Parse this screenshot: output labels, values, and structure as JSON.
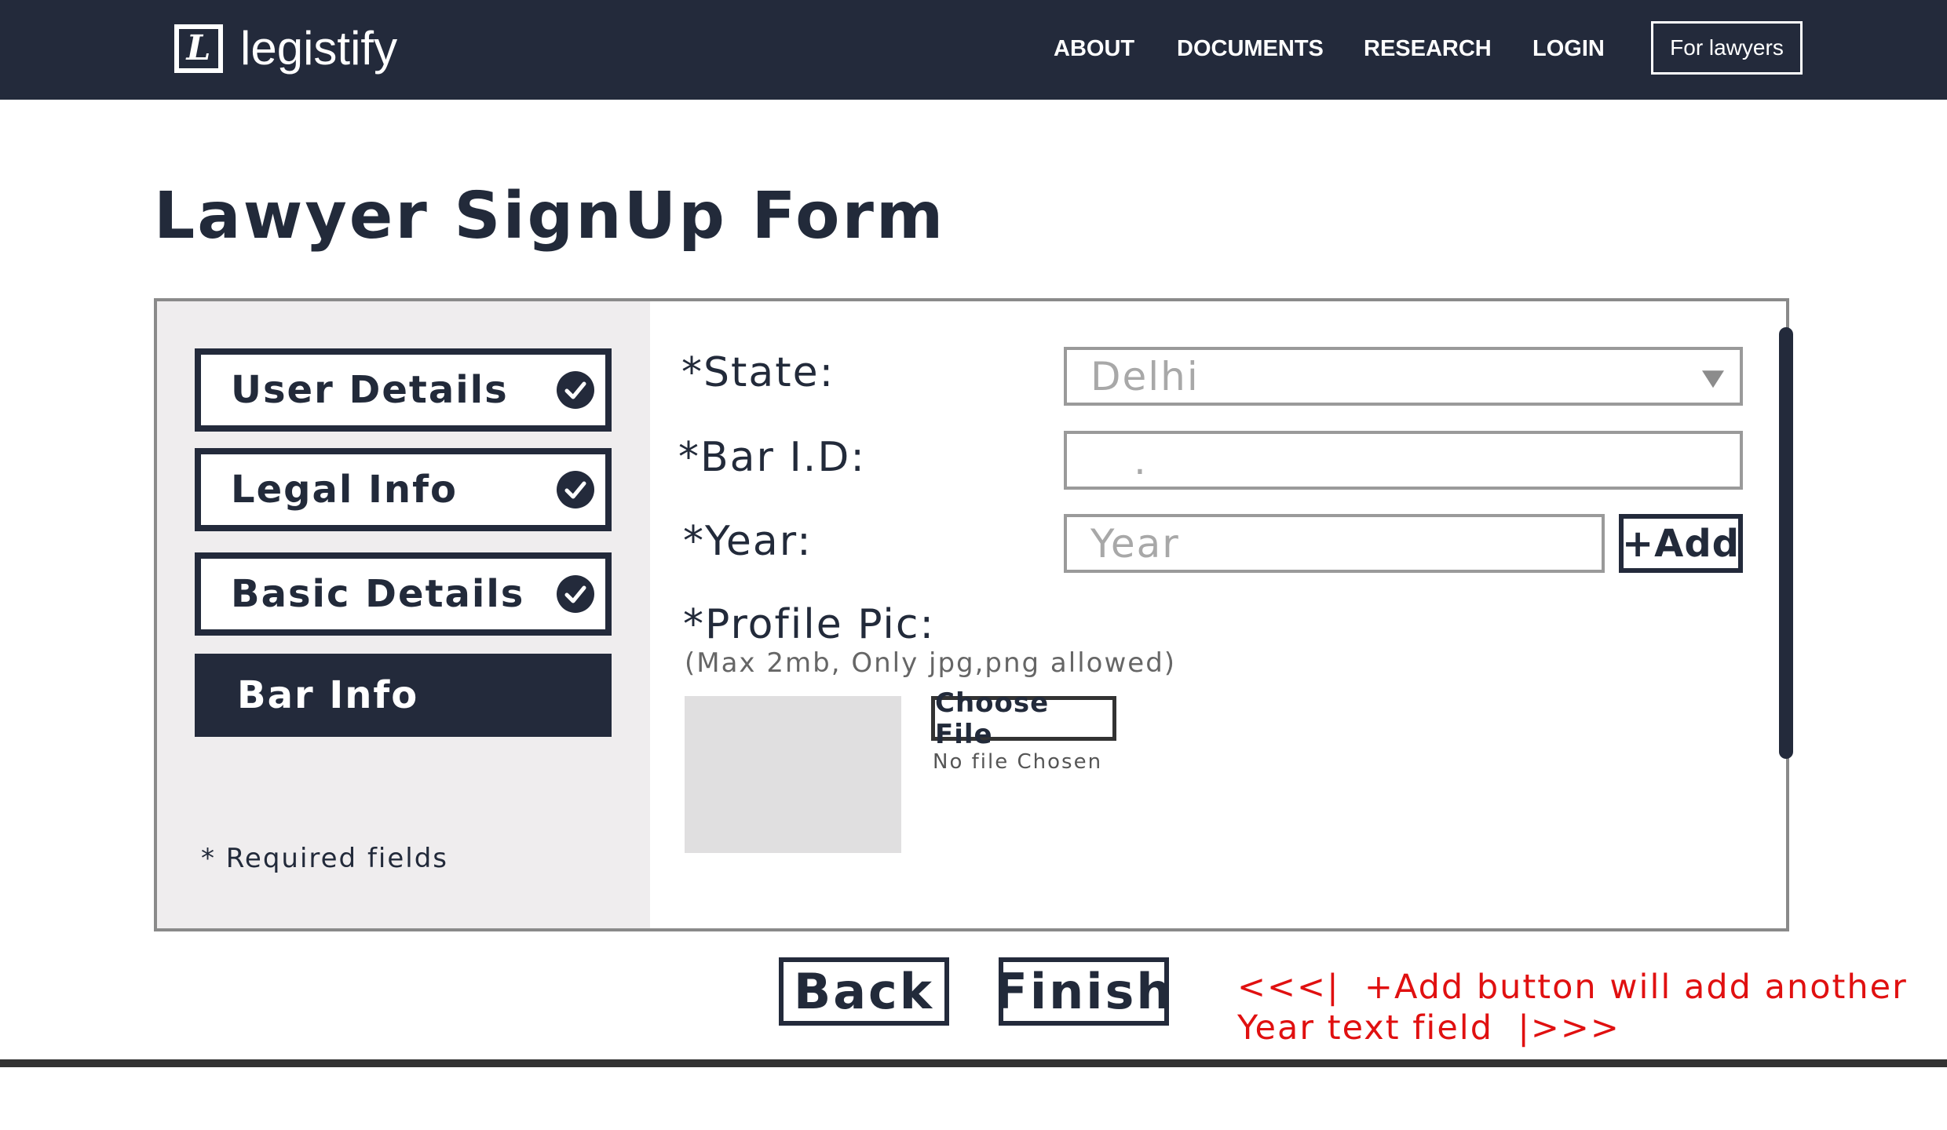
{
  "navbar": {
    "logo_letter": "L",
    "logo_text": "legistify",
    "links": [
      "ABOUT",
      "DOCUMENTS",
      "RESEARCH",
      "LOGIN"
    ],
    "cta_label": "For lawyers"
  },
  "page_title": "Lawyer SignUp Form",
  "sidebar": {
    "steps": [
      {
        "label": "User Details",
        "status": "complete",
        "icon": "check-circle-icon"
      },
      {
        "label": "Legal Info",
        "status": "complete",
        "icon": "check-circle-icon"
      },
      {
        "label": "Basic Details",
        "status": "complete",
        "icon": "check-circle-icon"
      },
      {
        "label": "Bar Info",
        "status": "active"
      }
    ],
    "required_note": "* Required fields"
  },
  "form": {
    "state": {
      "label": "*State:",
      "value": "Delhi",
      "icon": "chevron-down-icon"
    },
    "bar_id": {
      "label": "*Bar I.D:",
      "value": "."
    },
    "year": {
      "label": "*Year:",
      "placeholder": "Year",
      "add_label": "+Add"
    },
    "profile_pic": {
      "label": "*Profile Pic:",
      "hint": "(Max 2mb, Only jpg,png allowed)",
      "choose_label": "Choose File",
      "status": "No file Chosen"
    }
  },
  "actions": {
    "back_label": "Back",
    "finish_label": "Finish"
  },
  "annotation": {
    "line1": "<<<|  +Add button will add another",
    "line2": "Year text field  |>>>"
  },
  "colors": {
    "navy": "#232a3b",
    "annotation": "#e01010",
    "sidebar_bg": "#efedee"
  }
}
